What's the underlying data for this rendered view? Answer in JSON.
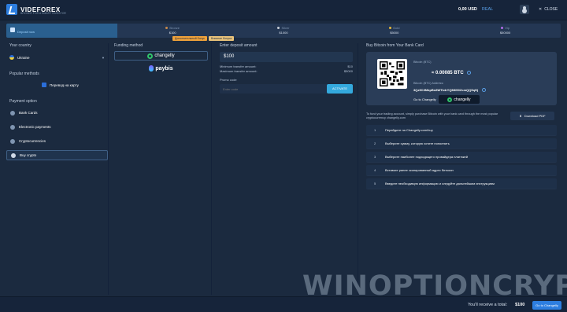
{
  "header": {
    "logo_text": "VIDEFOREX",
    "logo_sub": "BROKER FOR A SMART INVESTOR",
    "balance": "0,00 USD",
    "balance_tag": "REAL",
    "close_label": "CLOSE"
  },
  "tiers": [
    {
      "name": "Deposit now",
      "amount": ""
    },
    {
      "name": "Bronze",
      "amount": "$100"
    },
    {
      "name": "Silver",
      "amount": "$1000"
    },
    {
      "name": "Gold",
      "amount": "$5000"
    },
    {
      "name": "Vip",
      "amount": "$50000"
    }
  ],
  "bonus_tags": [
    "Дополнительный бонус",
    "Влияние бонуса"
  ],
  "left": {
    "country_label": "Your country",
    "country": "Ukraine",
    "popular_label": "Popular methods",
    "popular_item": "Перевод на карту",
    "payment_label": "Payment option",
    "options": [
      "Bank Cards",
      "Electronic payments",
      "Cryptocurrencies",
      "Buy crypto"
    ]
  },
  "funding": {
    "label": "Funding method",
    "provider1": "changelly",
    "provider2": "paybis"
  },
  "deposit": {
    "label": "Enter deposit amount",
    "amount": "$100",
    "min_label": "Minimum transfer amount:",
    "min_value": "$10",
    "max_label": "Maximum transfer amount:",
    "max_value": "$5000",
    "promo_label": "Promo code",
    "promo_placeholder": "Enter code",
    "activate_label": "ACTIVATE"
  },
  "buy": {
    "title": "Buy Bitcoin from Your Bank Card",
    "btc_label": "Bitcoin (BTC)",
    "btc_amount": "≈ 0.00085 BTC",
    "addr_label": "Bitcoin (BTC) Address:",
    "address": "3Qz9C3MbpBn8WTk4rYQM6S0ZcmQQ5qHj",
    "goto_label": "Go to Changelly",
    "goto_provider": "changelly",
    "instructions": "To fund your trading account, simply purchase Bitcoin with your bank card through the most popular cryptocurrency changelly.com",
    "pdf_label": "Download PDF",
    "steps": [
      "Перейдите на Changelly.com/buy",
      "Выберите сумму, которую хотите пополнить",
      "Выберите наиболее подходящего провайдера платежей",
      "Вставьте ранее скопированный адрес биткоин",
      "Введите необходимую информацию и следуйте дальнейшим инструкциям"
    ]
  },
  "footer": {
    "total_label": "You'll receive a total:",
    "total_value": "$100",
    "go_label": "Go to Changelly"
  },
  "watermark": "WINOPTIONCRYPTO.COM"
}
